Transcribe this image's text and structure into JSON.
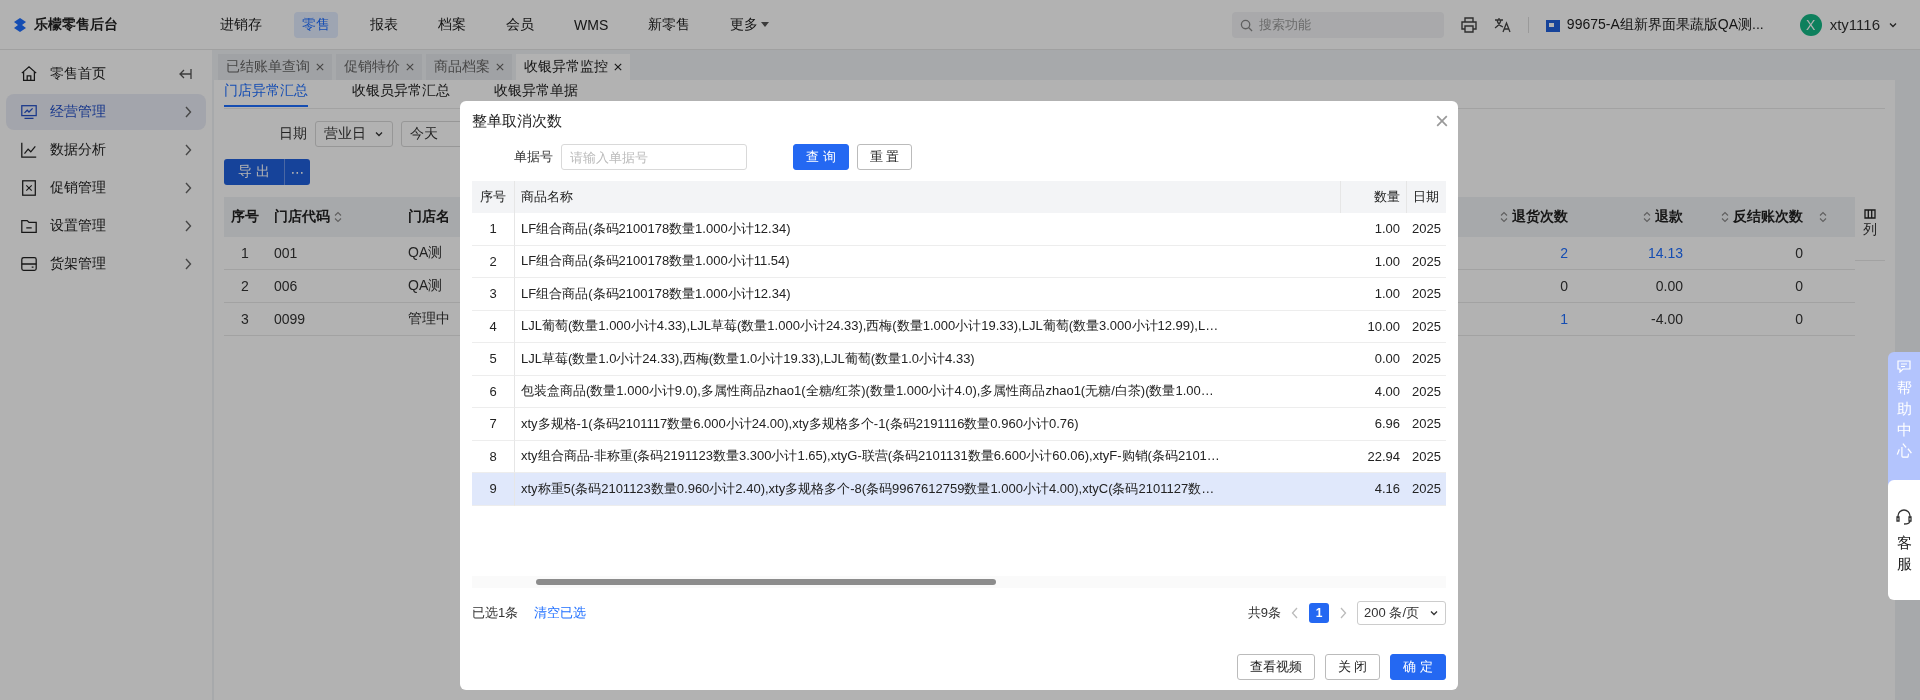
{
  "brand": {
    "name": "乐檬零售后台"
  },
  "top_nav": [
    {
      "label": "进销存",
      "selected": false,
      "has_menu": false
    },
    {
      "label": "零售",
      "selected": true,
      "has_menu": false
    },
    {
      "label": "报表",
      "selected": false,
      "has_menu": false
    },
    {
      "label": "档案",
      "selected": false,
      "has_menu": false
    },
    {
      "label": "会员",
      "selected": false,
      "has_menu": false
    },
    {
      "label": "WMS",
      "selected": false,
      "has_menu": false
    },
    {
      "label": "新零售",
      "selected": false,
      "has_menu": false
    },
    {
      "label": "更多",
      "selected": false,
      "has_menu": true
    }
  ],
  "search": {
    "placeholder": "搜索功能"
  },
  "store": {
    "label": "99675-A组新界面果蔬版QA测..."
  },
  "user": {
    "avatar_letter": "X",
    "name": "xty1116"
  },
  "sidebar": {
    "items": [
      {
        "label": "零售首页",
        "selected": false,
        "kind": "home"
      },
      {
        "label": "经营管理",
        "selected": true,
        "kind": "menu"
      },
      {
        "label": "数据分析",
        "selected": false,
        "kind": "menu"
      },
      {
        "label": "促销管理",
        "selected": false,
        "kind": "menu"
      },
      {
        "label": "设置管理",
        "selected": false,
        "kind": "menu"
      },
      {
        "label": "货架管理",
        "selected": false,
        "kind": "menu"
      }
    ]
  },
  "page_tabs": [
    {
      "label": "已结账单查询",
      "selected": false
    },
    {
      "label": "促销特价",
      "selected": false
    },
    {
      "label": "商品档案",
      "selected": false
    },
    {
      "label": "收银异常监控",
      "selected": true
    }
  ],
  "sub_tabs": [
    {
      "label": "门店异常汇总",
      "selected": true
    },
    {
      "label": "收银员异常汇总",
      "selected": false
    },
    {
      "label": "收银异常单据",
      "selected": false
    }
  ],
  "filter": {
    "label": "日期",
    "date_type": "营业日",
    "range": "今天"
  },
  "export": {
    "label": "导 出",
    "more": "⋯"
  },
  "store_table": {
    "left_columns": [
      "序号",
      "门店代码",
      "门店名"
    ],
    "right_columns": [
      "退货次数",
      "退款",
      "反结账次数"
    ],
    "settings_label": "列",
    "rows": [
      {
        "index": "1",
        "code": "001",
        "name": "QA测",
        "returns": {
          "text": "2",
          "link": true
        },
        "refund": {
          "text": "14.13",
          "link": true
        },
        "reverse": "0"
      },
      {
        "index": "2",
        "code": "006",
        "name": "QA测",
        "returns": {
          "text": "0",
          "link": false
        },
        "refund": {
          "text": "0.00",
          "link": false
        },
        "reverse": "0"
      },
      {
        "index": "3",
        "code": "0099",
        "name": "管理中",
        "returns": {
          "text": "1",
          "link": true
        },
        "refund": {
          "text": "-4.00",
          "link": false
        },
        "reverse": "0"
      }
    ]
  },
  "help": {
    "label": "帮助中心"
  },
  "service": {
    "label": "客服"
  },
  "dialog": {
    "title": "整单取消次数",
    "filter": {
      "label": "单据号",
      "placeholder": "请输入单据号"
    },
    "query_button": "查 询",
    "reset_button": "重 置",
    "columns": [
      "序号",
      "商品名称",
      "数量",
      "日期"
    ],
    "rows": [
      {
        "index": "1",
        "name": "LF组合商品(条码2100178数量1.000小计12.34)",
        "qty": "1.00",
        "date": "2025",
        "selected": false
      },
      {
        "index": "2",
        "name": "LF组合商品(条码2100178数量1.000小计11.54)",
        "qty": "1.00",
        "date": "2025",
        "selected": false
      },
      {
        "index": "3",
        "name": "LF组合商品(条码2100178数量1.000小计12.34)",
        "qty": "1.00",
        "date": "2025",
        "selected": false
      },
      {
        "index": "4",
        "name": "LJL葡萄(数量1.000小计4.33),LJL草莓(数量1.000小计24.33),西梅(数量1.000小计19.33),LJL葡萄(数量3.000小计12.99),L…",
        "qty": "10.00",
        "date": "2025",
        "selected": false
      },
      {
        "index": "5",
        "name": "LJL草莓(数量1.0小计24.33),西梅(数量1.0小计19.33),LJL葡萄(数量1.0小计4.33)",
        "qty": "0.00",
        "date": "2025",
        "selected": false
      },
      {
        "index": "6",
        "name": "包装盒商品(数量1.000小计9.0),多属性商品zhao1(全糖/红茶)(数量1.000小计4.0),多属性商品zhao1(无糖/白茶)(数量1.00…",
        "qty": "4.00",
        "date": "2025",
        "selected": false
      },
      {
        "index": "7",
        "name": "xty多规格-1(条码2101117数量6.000小计24.00),xty多规格多个-1(条码2191116数量0.960小计0.76)",
        "qty": "6.96",
        "date": "2025",
        "selected": false
      },
      {
        "index": "8",
        "name": "xty组合商品-非称重(条码2191123数量3.300小计1.65),xtyG-联营(条码2101131数量6.600小计60.06),xtyF-购销(条码2101…",
        "qty": "22.94",
        "date": "2025",
        "selected": false
      },
      {
        "index": "9",
        "name": "xty称重5(条码2101123数量0.960小计2.40),xty多规格多个-8(条码9967612759数量1.000小计4.00),xtyC(条码2101127数…",
        "qty": "4.16",
        "date": "2025",
        "selected": true
      }
    ],
    "selection_text": "已选1条",
    "clear_link": "清空已选",
    "total": "共9条",
    "pages": [
      {
        "label": "1",
        "selected": true
      }
    ],
    "page_size": "200 条/页",
    "buttons": [
      {
        "label": "查看视频",
        "kind": "default"
      },
      {
        "label": "关 闭",
        "kind": "default"
      },
      {
        "label": "确 定",
        "kind": "primary"
      }
    ]
  }
}
